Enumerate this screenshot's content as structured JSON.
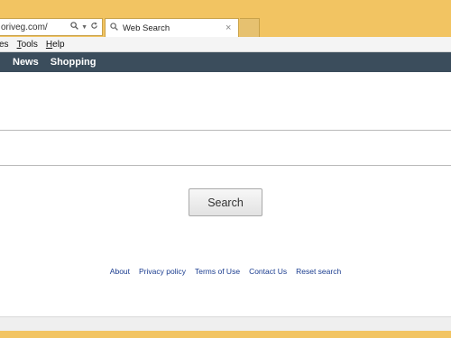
{
  "browser": {
    "address_url": "oriveg.com/",
    "tab_label": "Web Search",
    "close_glyph": "×"
  },
  "menu": {
    "items": [
      {
        "label": "es",
        "accel": ""
      },
      {
        "label": "ools",
        "accel": "T"
      },
      {
        "label": "elp",
        "accel": "H"
      }
    ]
  },
  "nav": {
    "items": [
      "News",
      "Shopping"
    ]
  },
  "search": {
    "value": "",
    "button_label": "Search"
  },
  "footer": {
    "links": [
      "About",
      "Privacy policy",
      "Terms of Use",
      "Contact Us",
      "Reset search"
    ]
  },
  "colors": {
    "frame": "#f2c462",
    "navbar": "#3b4d5c",
    "link": "#1a3c8f"
  }
}
